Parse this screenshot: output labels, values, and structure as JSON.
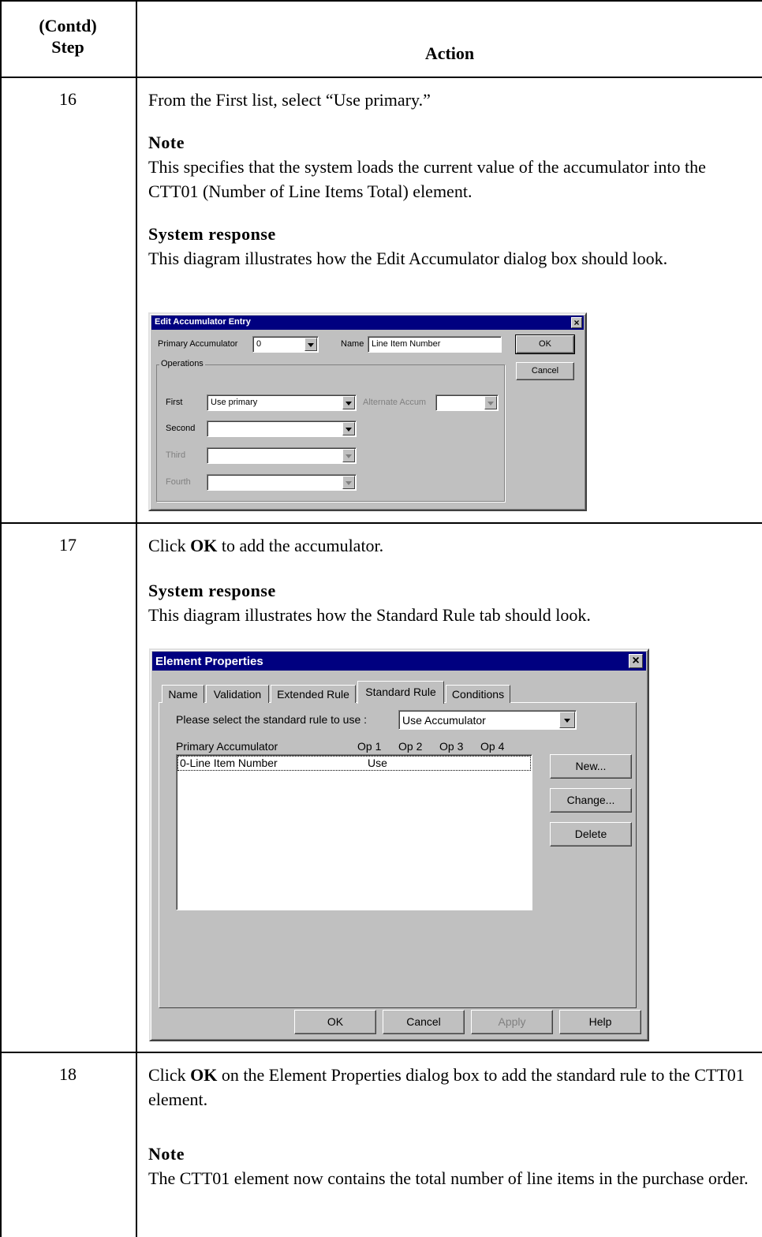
{
  "table": {
    "step_header": [
      "(Contd)",
      "Step"
    ],
    "action_header": "Action"
  },
  "steps": [
    {
      "number": "16",
      "action": "From the First list, select “Use primary.”",
      "note_heading": "Note",
      "note_text": "This specifies that the system loads the current value of the accumulator into the CTT01 (Number of Line Items Total) element.",
      "response_heading": "System response",
      "response_text": "This diagram illustrates how the Edit Accumulator dialog box should look."
    },
    {
      "number": "17",
      "action_prefix": "Click ",
      "action_bold": "OK",
      "action_suffix": " to add the accumulator.",
      "response_heading": "System response",
      "response_text": "This diagram illustrates how the Standard Rule tab should look."
    },
    {
      "number": "18",
      "action_prefix": "Click ",
      "action_bold": "OK",
      "action_suffix": " on the Element Properties dialog box to add the standard rule to the CTT01 element.",
      "note_heading": "Note",
      "note_text": "The CTT01 element now contains the total number of line items in the purchase order."
    }
  ],
  "edit_accumulator_dialog": {
    "title": "Edit Accumulator Entry",
    "close": "×",
    "primary_label": "Primary Accumulator",
    "primary_value": "0",
    "name_label": "Name",
    "name_value": "Line Item Number",
    "ok": "OK",
    "cancel": "Cancel",
    "group_label": "Operations",
    "first_label": "First",
    "first_value": "Use primary",
    "alternate_label": "Alternate Accum",
    "second_label": "Second",
    "third_label": "Third",
    "fourth_label": "Fourth"
  },
  "element_properties_dialog": {
    "title": "Element Properties",
    "close": "×",
    "tabs": [
      "Name",
      "Validation",
      "Extended Rule",
      "Standard Rule",
      "Conditions"
    ],
    "select_label": "Please select the standard rule to use :",
    "select_value": "Use Accumulator",
    "list_headers": [
      "Primary Accumulator",
      "Op 1",
      "Op 2",
      "Op 3",
      "Op 4"
    ],
    "list_rows": [
      {
        "name": "0-Line Item Number",
        "op1": "Use",
        "op2": "",
        "op3": "",
        "op4": ""
      }
    ],
    "side_buttons": [
      "New...",
      "Change...",
      "Delete"
    ],
    "footer_buttons": [
      "OK",
      "Cancel",
      "Apply",
      "Help"
    ]
  }
}
